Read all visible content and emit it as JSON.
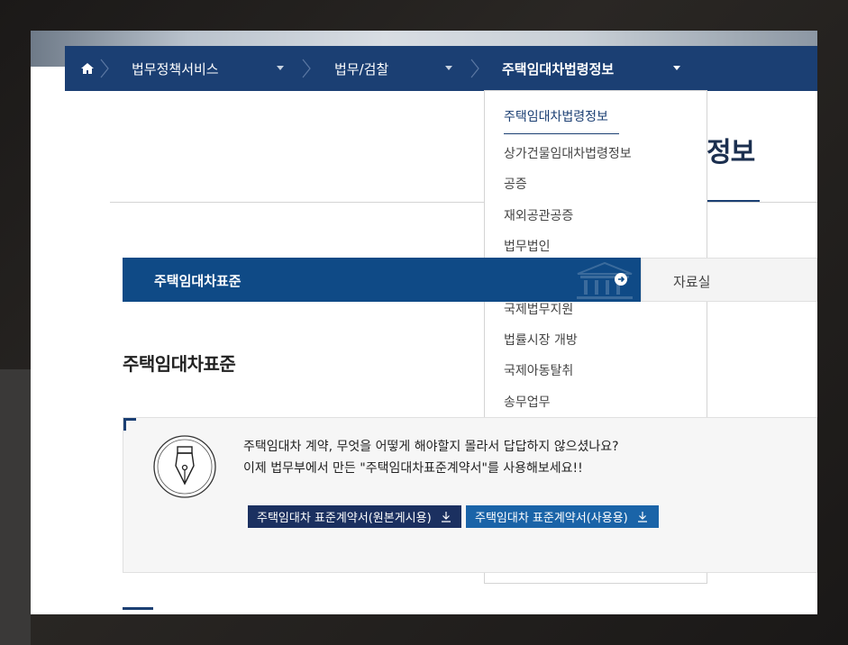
{
  "breadcrumb": {
    "home_icon": "home-icon",
    "items": [
      {
        "label": "법무정책서비스"
      },
      {
        "label": "법무/검찰"
      },
      {
        "label": "주택임대차법령정보"
      }
    ]
  },
  "dropdown": {
    "items": [
      {
        "label": "주택임대차법령정보",
        "selected": true
      },
      {
        "label": "상가건물임대차법령정보"
      },
      {
        "label": "공증"
      },
      {
        "label": "재외공관공증"
      },
      {
        "label": "법무법인"
      },
      {
        "label": "국제법무지원"
      },
      {
        "label": "법률시장 개방"
      },
      {
        "label": "국제아동탈취"
      },
      {
        "label": "송무업무"
      }
    ]
  },
  "page_title_tail": "정보",
  "tabs": {
    "active_label": "주택임대차표준",
    "other_label": "자료실"
  },
  "section_heading": "주택임대차표준",
  "notice": {
    "line1": "주택임대차 계약, 무엇을 어떻게 해야할지 몰라서 답답하지 않으셨나요?",
    "line2": "이제 법무부에서 만든 \"주택임대차표준계약서\"를 사용해보세요!!",
    "button_original": "주택임대차 표준계약서(원본게시용)",
    "button_use": "주택임대차 표준계약서(사용용)"
  },
  "colors": {
    "nav_bg": "#1b3f73",
    "tab_active_bg": "#0f4a86",
    "button_dark": "#1b3060",
    "button_blue": "#1a64a8"
  }
}
